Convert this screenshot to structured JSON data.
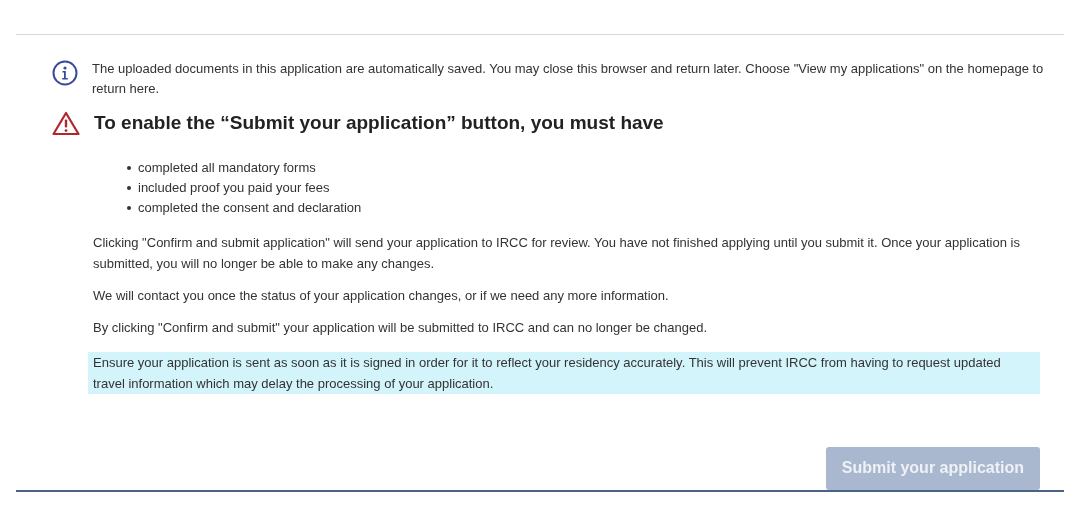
{
  "notice": {
    "text": "The uploaded documents in this application are automatically saved. You may close this browser and return later. Choose \"View my applications\" on the homepage to return here."
  },
  "warning": {
    "heading": "To enable the “Submit your application” button, you must have",
    "requirements": [
      "completed all mandatory forms",
      "included proof you paid your fees",
      "completed the consent and declaration"
    ]
  },
  "paragraphs": [
    {
      "text": "Clicking \"Confirm and submit application\" will send your application to IRCC for review. You have not finished applying until you submit it. Once your application is submitted, you will no longer be able to make any changes.",
      "highlighted": false
    },
    {
      "text": "We will contact you once the status of your application changes, or if we need any more information.",
      "highlighted": false
    },
    {
      "text": "By clicking \"Confirm and submit\" your application will be submitted to IRCC and can no longer be changed.",
      "highlighted": false
    },
    {
      "text": "Ensure your application is sent as soon as it is signed in order for it to reflect your residency accurately. This will prevent IRCC from having to request updated travel information which may delay the processing of your application.",
      "highlighted": true
    }
  ],
  "submit_button": {
    "label": "Submit your application",
    "disabled": true
  }
}
